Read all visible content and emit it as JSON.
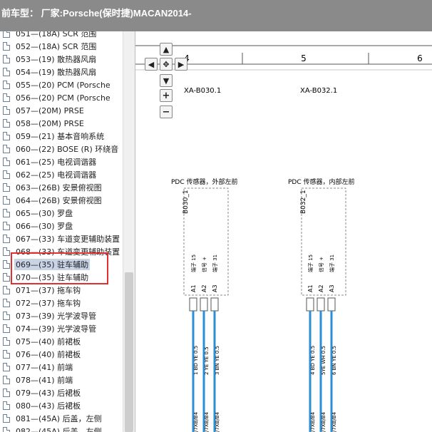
{
  "header": {
    "title": "前车型：  厂家:Porsche(保时捷)MACAN2014-"
  },
  "tree": {
    "items": [
      {
        "label": "051—(18A) SCR 范围"
      },
      {
        "label": "052—(18A) SCR 范围"
      },
      {
        "label": "053—(19) 散热器风扇"
      },
      {
        "label": "054—(19) 散热器风扇"
      },
      {
        "label": "055—(20) PCM (Porsche"
      },
      {
        "label": "056—(20) PCM (Porsche"
      },
      {
        "label": "057—(20M) PRSE"
      },
      {
        "label": "058—(20M) PRSE"
      },
      {
        "label": "059—(21) 基本音响系统"
      },
      {
        "label": "060—(22) BOSE (R) 环绕音"
      },
      {
        "label": "061—(25) 电视调谐器"
      },
      {
        "label": "062—(25) 电视调谐器"
      },
      {
        "label": "063—(26B) 安景俯视图"
      },
      {
        "label": "064—(26B) 安景俯视图"
      },
      {
        "label": "065—(30) 罗盘"
      },
      {
        "label": "066—(30) 罗盘"
      },
      {
        "label": "067—(33) 车道变更辅助装置"
      },
      {
        "label": "068—(33) 车道变更辅助装置"
      },
      {
        "label": "069—(35) 驻车辅助",
        "selected": true
      },
      {
        "label": "070—(35) 驻车辅助"
      },
      {
        "label": "071—(37) 拖车钩"
      },
      {
        "label": "072—(37) 拖车钩"
      },
      {
        "label": "073—(39) 光学波导管"
      },
      {
        "label": "074—(39) 光学波导管"
      },
      {
        "label": "075—(40) 前裙板"
      },
      {
        "label": "076—(40) 前裙板"
      },
      {
        "label": "077—(41) 前端"
      },
      {
        "label": "078—(41) 前端"
      },
      {
        "label": "079—(43) 后裙板"
      },
      {
        "label": "080—(43) 后裙板"
      },
      {
        "label": "081—(45A) 后盖，左侧"
      },
      {
        "label": "082—(45A) 后盖，左侧"
      }
    ]
  },
  "diagram": {
    "columns": {
      "col4": "4",
      "col5": "5",
      "col6": "6"
    },
    "refs": {
      "left": "XA-B030.1",
      "right": "XA-B032.1"
    },
    "left_sensor": {
      "title": "PDC 传感器，外部左前",
      "id": "B030_1",
      "pin_names": [
        "端子 15",
        "信号 +",
        "端子 31"
      ],
      "pins": [
        "A1",
        "A2",
        "A3"
      ],
      "wires": [
        "1 BD YE 0.5",
        "2 YE YE 0.5",
        "3 BN YE 0.5"
      ]
    },
    "right_sensor": {
      "title": "PDC 传感器，内部左前",
      "id": "B032_1",
      "pin_names": [
        "端子 15",
        "信号 +",
        "端子 31"
      ],
      "pins": [
        "A1",
        "A2",
        "A3"
      ],
      "wires": [
        "4 BD YE 0.5",
        "5YE WH 0.5",
        "6 BN YE 0.5"
      ]
    },
    "bottom_labels": [
      "/7XB/B4",
      "/7XB/B4",
      "/7XB/B4",
      "/7XB/B4",
      "/7XB/B4",
      "/7XB/B4"
    ]
  },
  "controls": {
    "up": "▲",
    "left": "◀",
    "center": "✥",
    "right": "▶",
    "down": "▼",
    "plus": "+",
    "minus": "−"
  },
  "colors": {
    "wire": "#2a8fd6",
    "titlebar": "#8a8a8a",
    "highlight": "#e03030"
  }
}
